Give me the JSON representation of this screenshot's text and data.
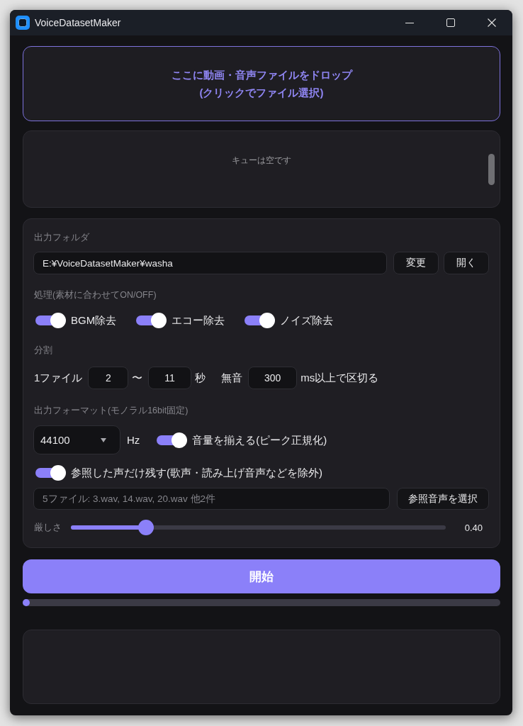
{
  "window": {
    "title": "VoiceDatasetMaker"
  },
  "drop_zone": {
    "lines": [
      "ここに動画・音声ファイルをドロップ",
      "(クリックでファイル選択)"
    ]
  },
  "queue": {
    "empty_message": "キューは空です"
  },
  "output_folder": {
    "label": "出力フォルダ",
    "path": "E:¥VoiceDatasetMaker¥washa",
    "buttons": [
      "変更",
      "開く"
    ]
  },
  "processing": {
    "label": "処理(素材に合わせてON/OFF)",
    "switches": [
      {
        "label": "BGM除去",
        "on": true
      },
      {
        "label": "エコー除去",
        "on": true
      },
      {
        "label": "ノイズ除去",
        "on": true
      }
    ]
  },
  "split": {
    "label": "分割",
    "items": [
      {
        "kind": "text",
        "text": "1ファイル"
      },
      {
        "kind": "field",
        "value": "2"
      },
      {
        "kind": "text",
        "text": "〜"
      },
      {
        "kind": "field",
        "value": "11"
      },
      {
        "kind": "text",
        "text": "秒"
      },
      {
        "kind": "text",
        "text": "無音"
      },
      {
        "kind": "field",
        "value": "300"
      },
      {
        "kind": "text",
        "text": "ms以上で区切る"
      }
    ]
  },
  "format": {
    "label": "出力フォーマット(モノラル16bit固定)",
    "sample_rate": "44100",
    "unit": "Hz",
    "normalize": {
      "label": "音量を揃える(ピーク正規化)",
      "on": true
    }
  },
  "reference": {
    "filter": {
      "label": "参照した声だけ残す(歌声・読み上げ音声などを除外)",
      "on": true
    },
    "files": {
      "value": "5ファイル: 3.wav, 14.wav, 20.wav 他2件",
      "disabled": true
    },
    "button": "参照音声を選択",
    "strictness": {
      "label": "厳しさ",
      "level": 0.2,
      "reading": "0.40"
    }
  },
  "start_button": "開始",
  "progress": {
    "level": 0
  }
}
